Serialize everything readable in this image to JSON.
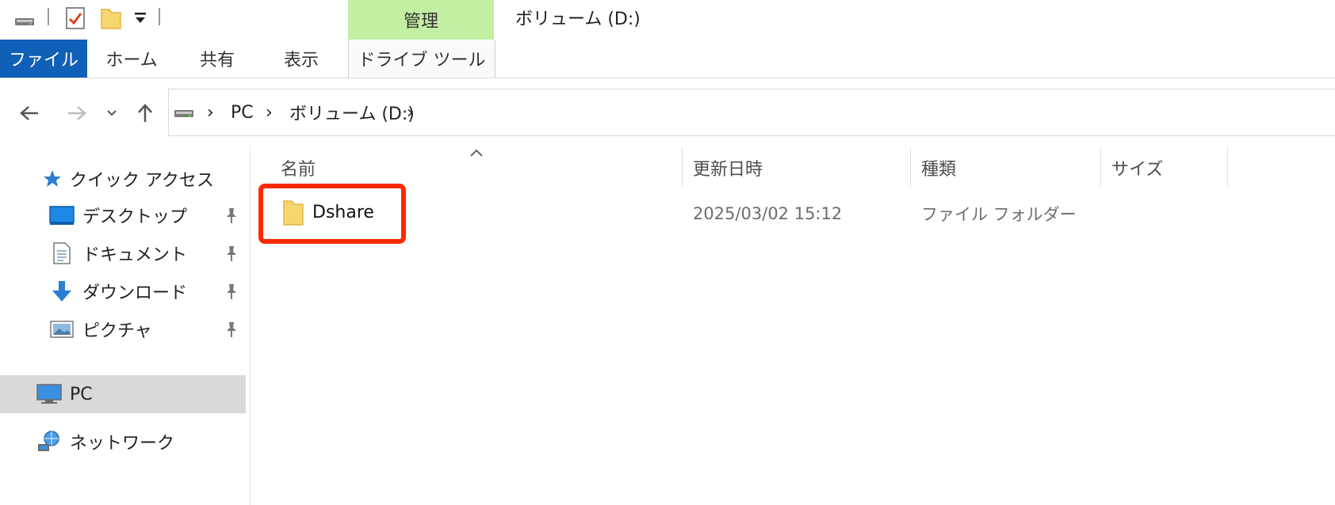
{
  "window": {
    "title": "ボリューム (D:)"
  },
  "ribbon": {
    "context_group": "管理",
    "tabs": [
      {
        "label": "ファイル"
      },
      {
        "label": "ホーム"
      },
      {
        "label": "共有"
      },
      {
        "label": "表示"
      },
      {
        "label": "ドライブ ツール"
      }
    ]
  },
  "address": {
    "crumbs": [
      "PC",
      "ボリューム (D:)"
    ]
  },
  "nav": {
    "quick_access": "クイック アクセス",
    "items": [
      {
        "label": "デスクトップ",
        "icon": "desktop-icon",
        "pinned": true
      },
      {
        "label": "ドキュメント",
        "icon": "document-icon",
        "pinned": true
      },
      {
        "label": "ダウンロード",
        "icon": "download-arrow-icon",
        "pinned": true
      },
      {
        "label": "ピクチャ",
        "icon": "picture-icon",
        "pinned": true
      }
    ],
    "pc": "PC",
    "network": "ネットワーク"
  },
  "list": {
    "columns": {
      "name": "名前",
      "modified": "更新日時",
      "type": "種類",
      "size": "サイズ"
    },
    "rows": [
      {
        "name": "Dshare",
        "modified": "2025/03/02 15:12",
        "type": "ファイル フォルダー",
        "size": ""
      }
    ]
  },
  "colors": {
    "file_tab": "#1160b7",
    "manage_tab": "#c2efa2",
    "highlight": "#ff2a00",
    "folder": "#f8d66f"
  }
}
